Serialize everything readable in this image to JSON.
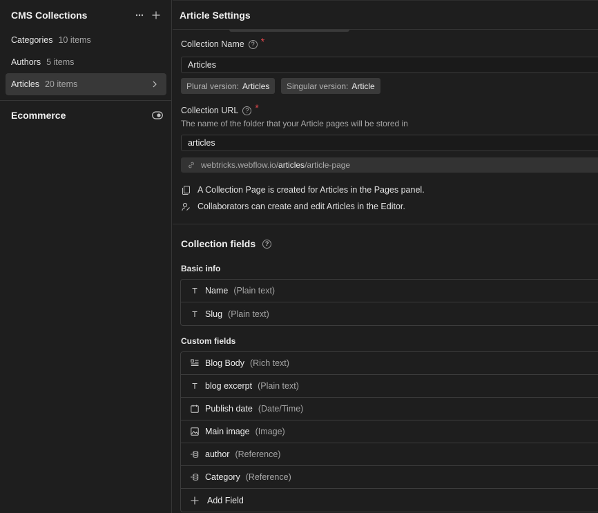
{
  "sidebar": {
    "title": "CMS Collections",
    "collections": [
      {
        "name": "Categories",
        "count": "10 items"
      },
      {
        "name": "Authors",
        "count": "5 items"
      },
      {
        "name": "Articles",
        "count": "20 items"
      }
    ],
    "ecommerce_title": "Ecommerce"
  },
  "settings": {
    "title": "Article Settings",
    "name_label": "Collection Name",
    "name_value": "Articles",
    "plural_key": "Plural version:",
    "plural_value": "Articles",
    "singular_key": "Singular version:",
    "singular_value": "Article",
    "url_label": "Collection URL",
    "url_hint": "The name of the folder that your Article pages will be stored in",
    "url_value": "articles",
    "preview_domain": "webtricks.webflow.io/",
    "preview_folder": "articles",
    "preview_page": "/article-page",
    "info_pages": "A Collection Page is created for Articles in the Pages panel.",
    "info_editor": "Collaborators can create and edit Articles in the Editor."
  },
  "fields": {
    "title": "Collection fields",
    "basic_label": "Basic info",
    "basic": [
      {
        "name": "Name",
        "type": "(Plain text)",
        "icon": "text-icon"
      },
      {
        "name": "Slug",
        "type": "(Plain text)",
        "icon": "text-icon"
      }
    ],
    "custom_label": "Custom fields",
    "custom": [
      {
        "name": "Blog Body",
        "type": "(Rich text)",
        "icon": "rich-text-icon"
      },
      {
        "name": "blog excerpt",
        "type": "(Plain text)",
        "icon": "text-icon"
      },
      {
        "name": "Publish date",
        "type": "(Date/Time)",
        "icon": "calendar-icon"
      },
      {
        "name": "Main image",
        "type": "(Image)",
        "icon": "image-icon"
      },
      {
        "name": "author",
        "type": "(Reference)",
        "icon": "reference-icon"
      },
      {
        "name": "Category",
        "type": "(Reference)",
        "icon": "reference-icon"
      }
    ],
    "add_label": "Add Field"
  },
  "colors": {
    "background": "#1e1e1e",
    "active_item": "#383838",
    "required": "#e5484d"
  }
}
